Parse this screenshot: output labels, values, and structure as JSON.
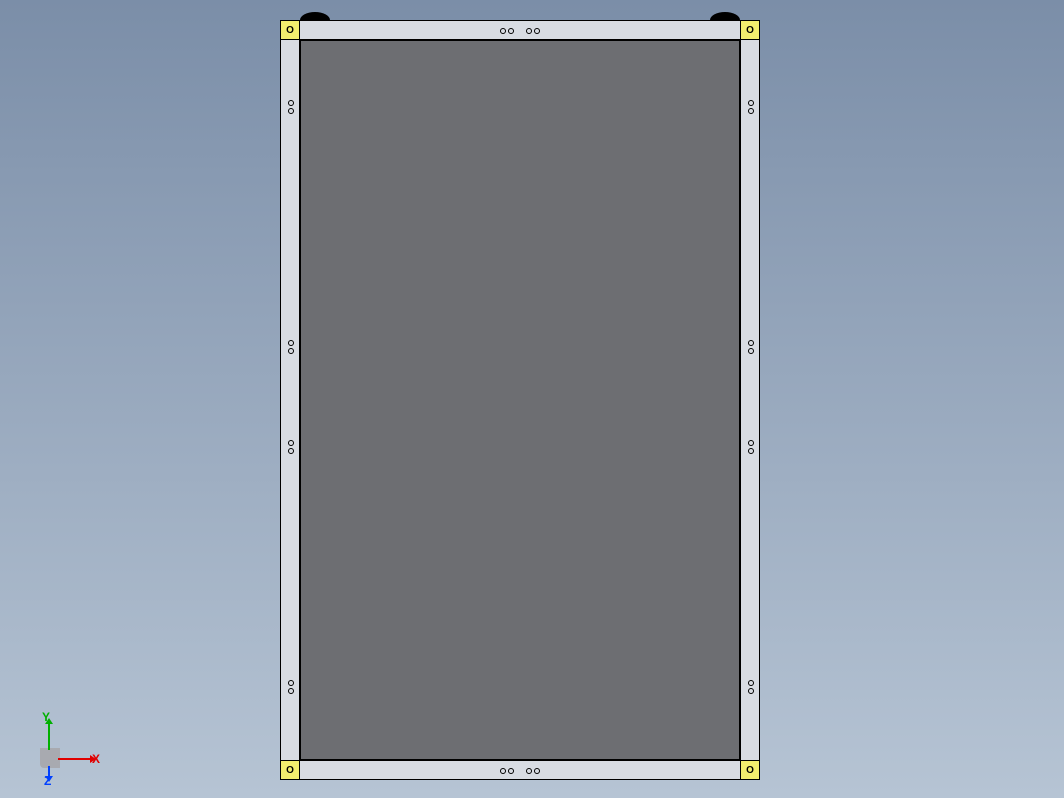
{
  "corners": {
    "top_left": "O",
    "top_right": "O",
    "bottom_left": "O",
    "bottom_right": "O"
  },
  "axes": {
    "x_label": "X",
    "y_label": "Y",
    "z_label": "Z",
    "x_color": "#e00000",
    "y_color": "#00b000",
    "z_color": "#0040ff"
  }
}
